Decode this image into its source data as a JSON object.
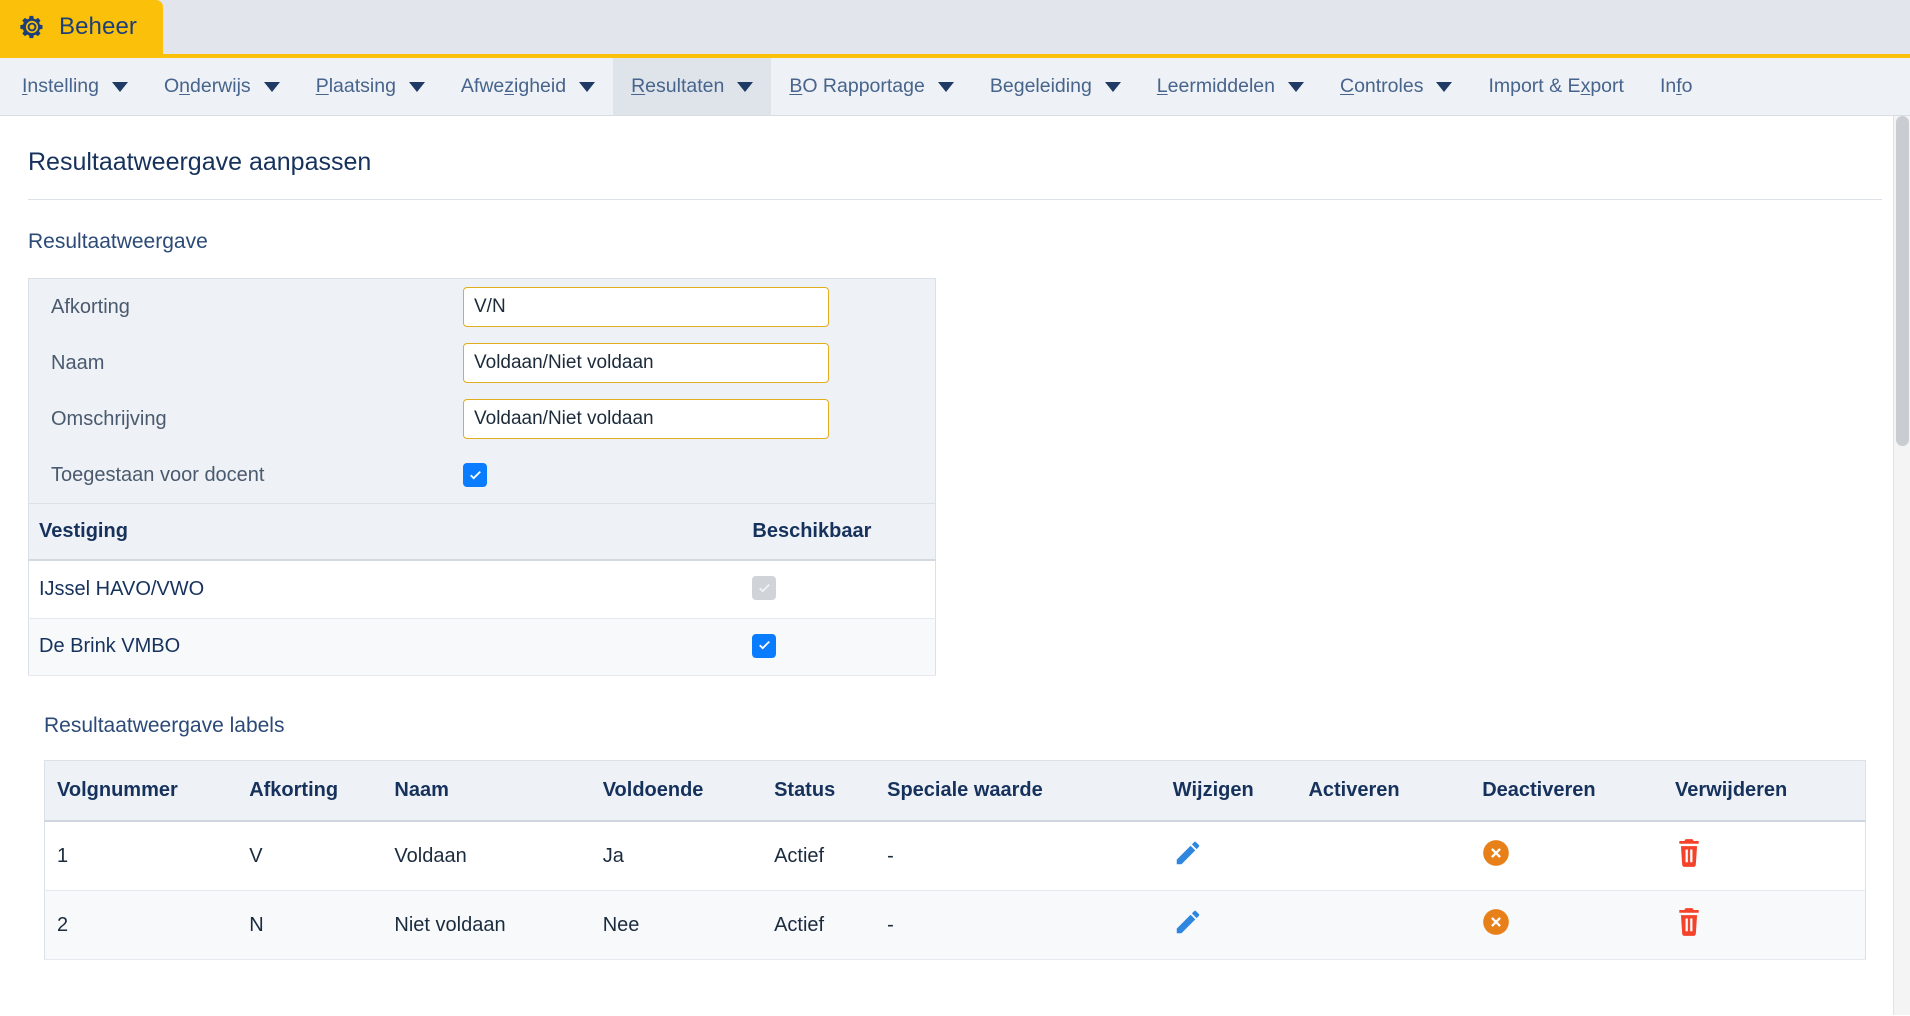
{
  "app": {
    "tab_label": "Beheer",
    "tab_icon": "gear-icon",
    "tab_bg": "#fbc10a",
    "tab_text_color": "#1d3f79"
  },
  "menubar": {
    "items": [
      {
        "label": "Instelling",
        "accel": "I",
        "has_caret": true,
        "active": false
      },
      {
        "label": "Onderwijs",
        "accel": "n",
        "has_caret": true,
        "active": false
      },
      {
        "label": "Plaatsing",
        "accel": "P",
        "has_caret": true,
        "active": false
      },
      {
        "label": "Afwezigheid",
        "accel": "z",
        "has_caret": true,
        "active": false
      },
      {
        "label": "Resultaten",
        "accel": "R",
        "has_caret": true,
        "active": true
      },
      {
        "label": "BO Rapportage",
        "accel": "B",
        "has_caret": true,
        "active": false
      },
      {
        "label": "Begeleiding",
        "accel": "g",
        "has_caret": true,
        "active": false
      },
      {
        "label": "Leermiddelen",
        "accel": "L",
        "has_caret": true,
        "active": false
      },
      {
        "label": "Controles",
        "accel": "C",
        "has_caret": true,
        "active": false
      },
      {
        "label": "Import & Export",
        "accel": "x",
        "has_caret": false,
        "active": false
      },
      {
        "label": "Info",
        "accel": "f",
        "has_caret": false,
        "active": false
      }
    ]
  },
  "page": {
    "title": "Resultaatweergave aanpassen",
    "section_title": "Resultaatweergave"
  },
  "form": {
    "fields": [
      {
        "label": "Afkorting",
        "value": "V/N",
        "type": "text"
      },
      {
        "label": "Naam",
        "value": "Voldaan/Niet voldaan",
        "type": "text"
      },
      {
        "label": "Omschrijving",
        "value": "Voldaan/Niet voldaan",
        "type": "text"
      }
    ],
    "checkbox_row": {
      "label": "Toegestaan voor docent",
      "checked": true,
      "enabled": true
    },
    "input_border_color": "#e0ae1f",
    "panel_bg": "#eef1f5"
  },
  "vestiging_table": {
    "headers": [
      "Vestiging",
      "Beschikbaar"
    ],
    "rows": [
      {
        "vestiging": "IJssel HAVO/VWO",
        "beschikbaar": true,
        "disabled": true
      },
      {
        "vestiging": "De Brink VMBO",
        "beschikbaar": true,
        "disabled": false
      }
    ]
  },
  "labels_section": {
    "title": "Resultaatweergave labels",
    "headers": [
      "Volgnummer",
      "Afkorting",
      "Naam",
      "Voldoende",
      "Status",
      "Speciale waarde",
      "Wijzigen",
      "Activeren",
      "Deactiveren",
      "Verwijderen"
    ],
    "rows": [
      {
        "volgnummer": "1",
        "afkorting": "V",
        "naam": "Voldaan",
        "voldoende": "Ja",
        "status": "Actief",
        "speciale_waarde": "-",
        "wijzigen_icon": "pencil-icon",
        "activeren_icon": "",
        "deactiveren_icon": "deactivate-circle-x-icon",
        "verwijderen_icon": "trash-icon"
      },
      {
        "volgnummer": "2",
        "afkorting": "N",
        "naam": "Niet voldaan",
        "voldoende": "Nee",
        "status": "Actief",
        "speciale_waarde": "-",
        "wijzigen_icon": "pencil-icon",
        "activeren_icon": "",
        "deactiveren_icon": "deactivate-circle-x-icon",
        "verwijderen_icon": "trash-icon"
      }
    ]
  },
  "colors": {
    "accent_yellow": "#fbc10a",
    "menu_text": "#47648c",
    "heading": "#16325c",
    "checkbox_blue": "#0a7cff",
    "pencil_blue": "#2e86de",
    "deactivate_orange": "#e8801a",
    "trash_red": "#f4432a"
  }
}
